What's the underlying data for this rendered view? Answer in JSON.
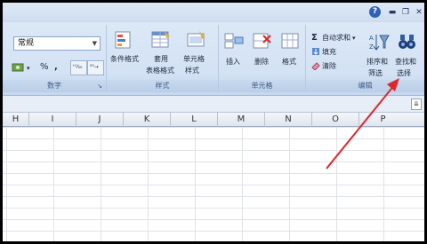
{
  "ribbon": {
    "number_group": {
      "format_value": "常规",
      "percent_symbol": "%",
      "comma_symbol": ",",
      "inc_decimal_label": "⁺⁰⁄₀₀",
      "label": "数字"
    },
    "style_group": {
      "conditional_format": "条件格式",
      "table_format_line1": "套用",
      "table_format_line2": "表格格式",
      "cell_style_line1": "单元格",
      "cell_style_line2": "样式",
      "label": "样式"
    },
    "cells_group": {
      "insert": "插入",
      "delete": "删除",
      "format": "格式",
      "label": "单元格"
    },
    "edit_group": {
      "autosum": "自动求和",
      "fill": "填充",
      "clear": "清除",
      "sort_line1": "排序和",
      "sort_line2": "筛选",
      "find_line1": "查找和",
      "find_line2": "选择",
      "label": "编辑"
    }
  },
  "sheet": {
    "partial_col": "H",
    "columns": [
      "I",
      "J",
      "K",
      "L",
      "M",
      "N",
      "O",
      "P"
    ]
  },
  "colors": {
    "annotation_arrow": "#e0262a",
    "ribbon_bg": "#d3e2f4"
  }
}
